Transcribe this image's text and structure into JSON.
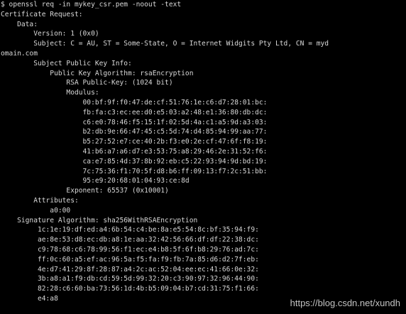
{
  "terminal": {
    "background": "#000000",
    "text_color": "#d8d8d8",
    "lines": [
      "$ openssl req -in mykey_csr.pem -noout -text",
      "Certificate Request:",
      "    Data:",
      "        Version: 1 (0x0)",
      "        Subject: C = AU, ST = Some-State, O = Internet Widgits Pty Ltd, CN = myd",
      "omain.com",
      "        Subject Public Key Info:",
      "            Public Key Algorithm: rsaEncryption",
      "                RSA Public-Key: (1024 bit)",
      "                Modulus:",
      "                    00:bf:9f:f0:47:de:cf:51:76:1e:c6:d7:28:01:bc:",
      "                    fb:fa:c3:ec:ee:d0:e5:03:a2:48:e1:36:80:db:dc:",
      "                    c6:e0:78:46:f5:15:1f:02:5d:4a:c1:a5:9d:a3:03:",
      "                    b2:db:9e:66:47:45:c5:5d:74:d4:85:94:99:aa:77:",
      "                    b5:27:52:e7:ce:40:2b:f3:e0:2e:cf:47:6f:f8:19:",
      "                    41:b6:a7:a6:d7:e3:53:75:a8:29:46:2e:31:52:f6:",
      "                    ca:e7:85:4d:37:8b:92:eb:c5:22:93:94:9d:bd:19:",
      "                    7c:75:36:f1:70:5f:d8:b6:ff:09:13:f7:2c:51:bb:",
      "                    95:e9:20:68:01:04:93:ce:8d",
      "                Exponent: 65537 (0x10001)",
      "        Attributes:",
      "            a0:00",
      "    Signature Algorithm: sha256WithRSAEncryption",
      "         1c:1e:19:df:ed:a4:6b:54:c4:be:8a:e5:54:8c:bf:35:94:f9:",
      "         ae:8e:53:d8:ec:db:a8:1e:aa:32:42:56:66:df:df:22:38:dc:",
      "         c9:78:68:c6:78:99:56:f1:ec:e4:b8:5f:6f:b8:29:76:ad:7c:",
      "         ff:0c:60:a5:ef:ac:96:5a:f5:fa:f9:fb:7a:85:d6:d2:7f:eb:",
      "         4e:d7:41:29:8f:28:87:a4:2c:ac:52:04:ee:ec:41:66:0e:32:",
      "         3b:a8:a1:f9:db:cd:59:5d:99:32:20:c3:90:97:32:96:44:90:",
      "         82:28:c6:60:ba:73:56:1d:4b:b5:09:04:b7:cd:31:75:f1:66:",
      "         e4:a8"
    ]
  },
  "watermark": {
    "text": "https://blog.csdn.net/xundh"
  }
}
